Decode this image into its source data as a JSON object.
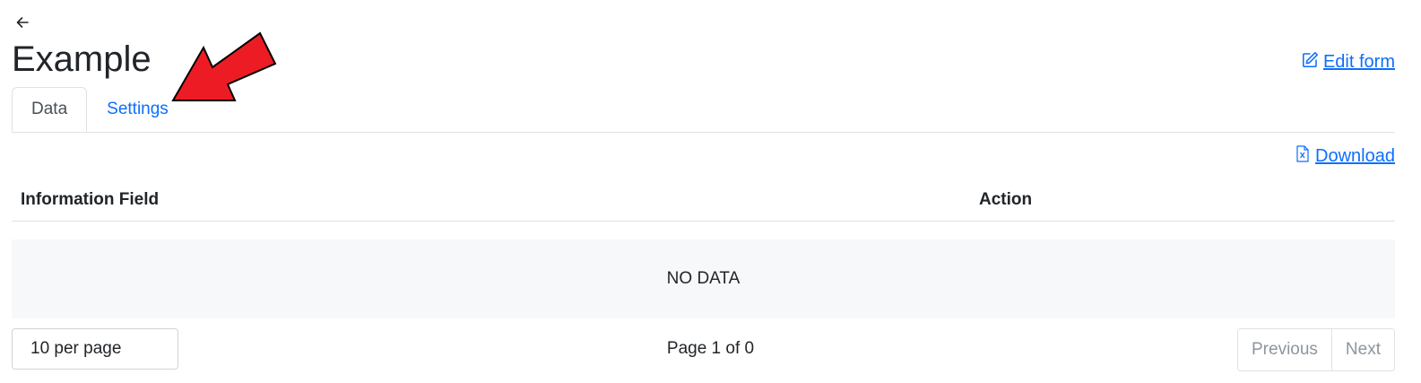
{
  "header": {
    "title": "Example",
    "edit_form_label": "Edit form"
  },
  "tabs": [
    {
      "label": "Data",
      "active": true
    },
    {
      "label": "Settings",
      "active": false
    }
  ],
  "toolbar": {
    "download_label": "Download"
  },
  "table": {
    "columns": [
      "Information Field",
      "Action"
    ],
    "empty_text": "NO DATA"
  },
  "pagination": {
    "per_page_label": "10 per page",
    "page_info": "Page 1 of 0",
    "previous_label": "Previous",
    "next_label": "Next"
  },
  "colors": {
    "link": "#0d6efd",
    "annotation_arrow": "#ed1c24"
  },
  "icons": [
    "arrow-left-icon",
    "edit-icon",
    "excel-file-icon"
  ]
}
